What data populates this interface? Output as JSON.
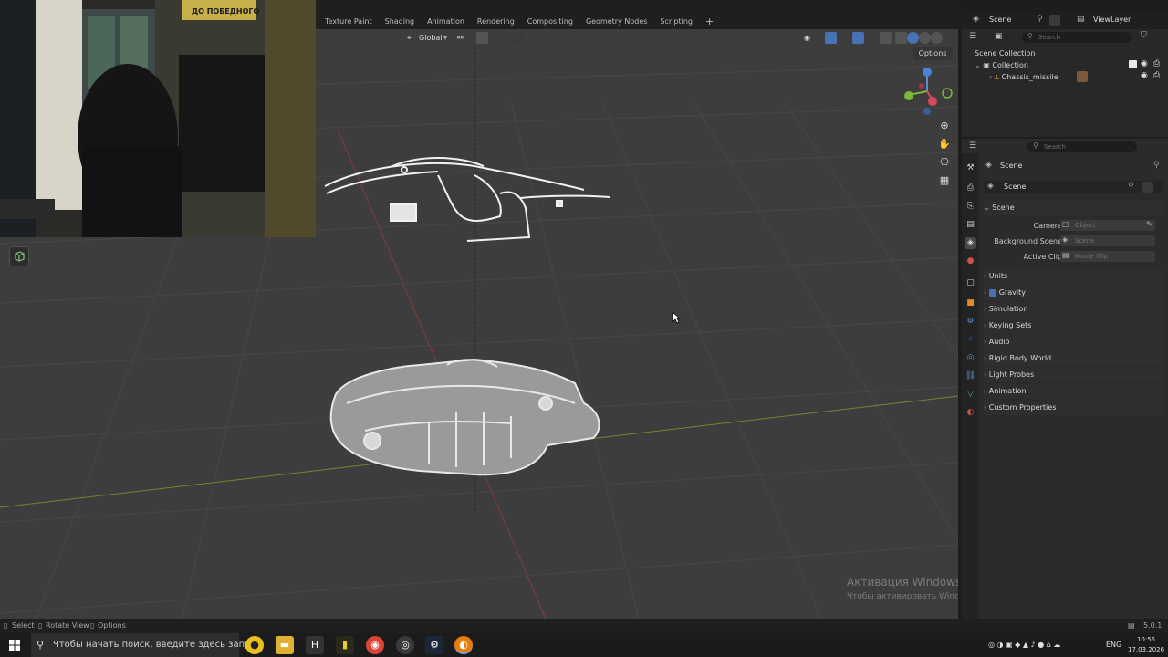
{
  "workspace_tabs": [
    "Texture Paint",
    "Shading",
    "Animation",
    "Rendering",
    "Compositing",
    "Geometry Nodes",
    "Scripting"
  ],
  "workspace_add": "+",
  "viewport": {
    "transform_orientation": "Global",
    "options_label": "Options",
    "watermark_title": "Активация Windows",
    "watermark_text": "Чтобы активировать Windows, перейдите в раздел \"Параметры\".",
    "webcam_sign": "ДО ПОБЕДНОГО"
  },
  "topright": {
    "scene_name": "Scene",
    "view_layer": "ViewLayer"
  },
  "outliner": {
    "search_placeholder": "Search",
    "scene_collection": "Scene Collection",
    "collection": "Collection",
    "object": "Chassis_missile"
  },
  "properties": {
    "search_placeholder": "Search",
    "breadcrumb": "Scene",
    "datablock": "Scene",
    "scene_panel": "Scene",
    "camera_label": "Camera",
    "camera_placeholder": "Object",
    "background_label": "Background Scene",
    "background_placeholder": "Scene",
    "clip_label": "Active Clip",
    "clip_placeholder": "Movie Clip",
    "panels": [
      "Units",
      "Gravity",
      "Simulation",
      "Keying Sets",
      "Audio",
      "Rigid Body World",
      "Light Probes",
      "Animation",
      "Custom Properties"
    ]
  },
  "statusbar": {
    "select": "Select",
    "rotate": "Rotate View",
    "options": "Options",
    "version": "5.0.1"
  },
  "taskbar": {
    "search_placeholder": "Чтобы начать поиск, введите здесь запрос",
    "language": "ENG",
    "time": "10:55",
    "date": "17.03.2026"
  }
}
